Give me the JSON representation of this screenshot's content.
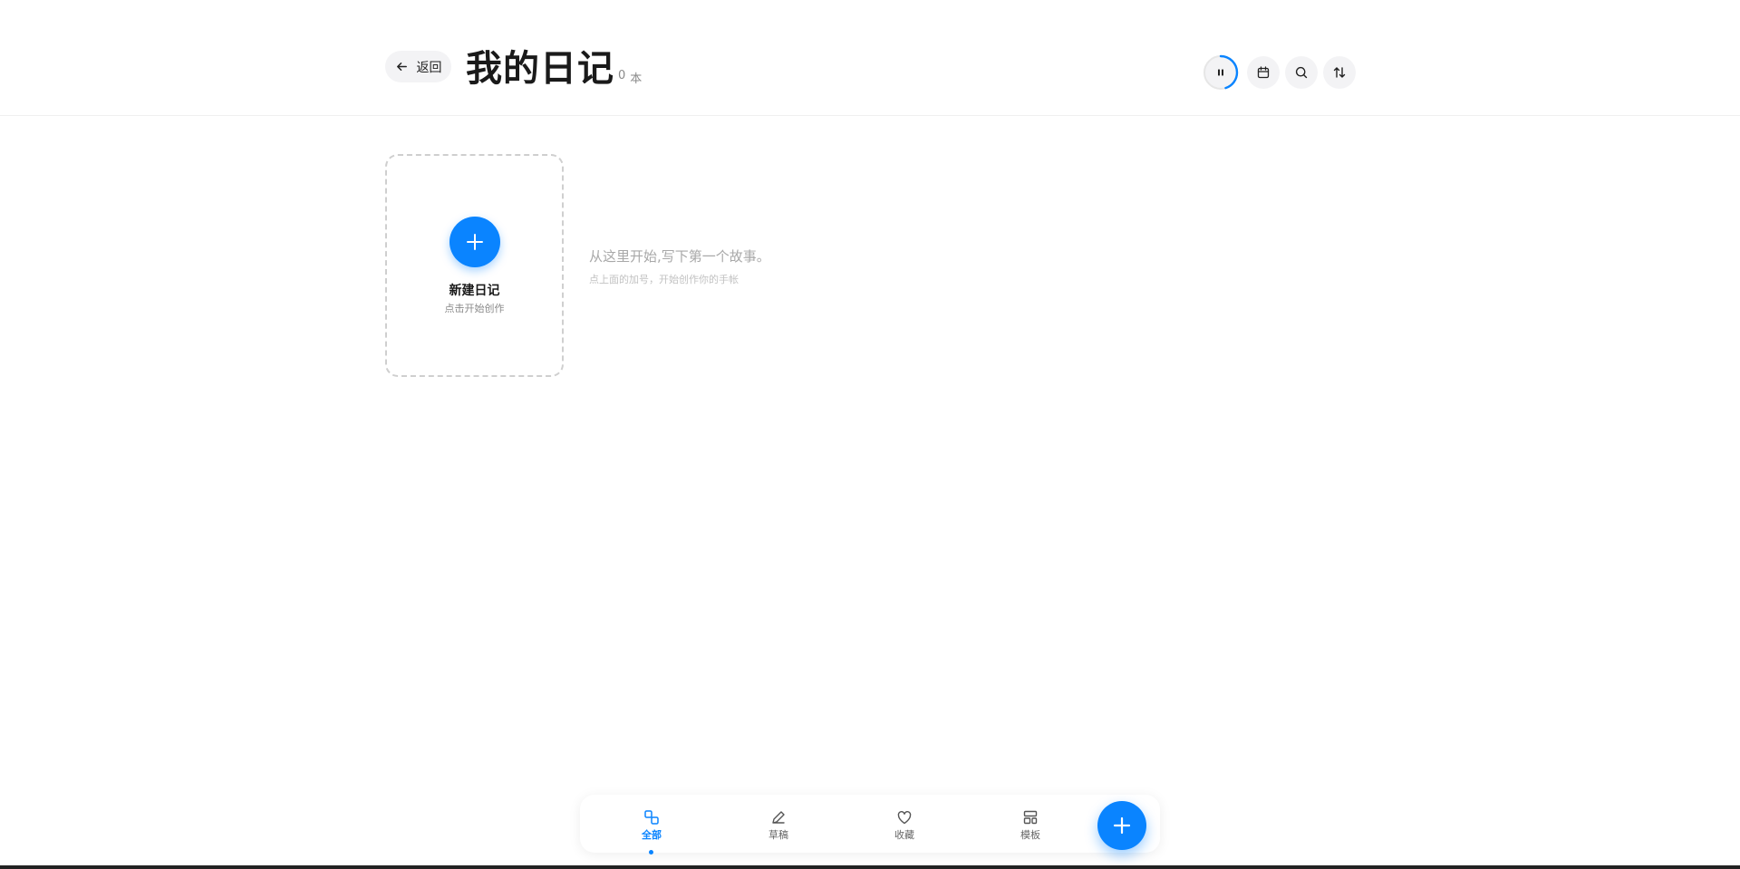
{
  "header": {
    "back_label": "返回",
    "title": "我的日记",
    "count_value": "0",
    "count_unit": "本"
  },
  "toolbar": {
    "timer_progress": 0.45,
    "icons": [
      "pause-icon",
      "calendar-icon",
      "search-icon",
      "sort-icon"
    ]
  },
  "new_card": {
    "title": "新建日记",
    "subtitle": "点击开始创作"
  },
  "empty_state": {
    "message": "从这里开始,写下第一个故事。",
    "hint": "点上面的加号，开始创作你的手帐"
  },
  "bottom_nav": {
    "items": [
      {
        "label": "全部",
        "icon": "all-icon",
        "active": true
      },
      {
        "label": "草稿",
        "icon": "pencil-icon",
        "active": false
      },
      {
        "label": "收藏",
        "icon": "heart-icon",
        "active": false
      },
      {
        "label": "模板",
        "icon": "template-icon",
        "active": false
      }
    ]
  },
  "colors": {
    "accent": "#0a84ff",
    "text": "#1a1a1a",
    "muted": "#8a8a8a"
  }
}
